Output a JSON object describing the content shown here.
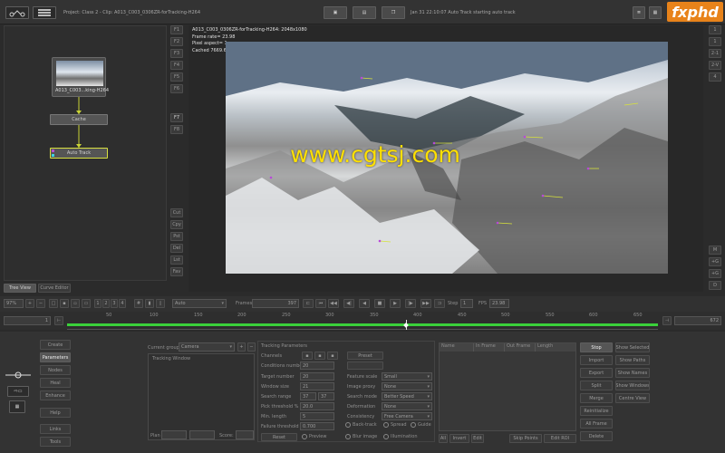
{
  "top_bar": {
    "project_label": "Project: Class 2 - Clip: A013_C003_0306ZR-forTracking-H264",
    "status_message": "Jan 31 22:10:07 Auto Track starting auto track",
    "watermark": "fxphd"
  },
  "node_graph": {
    "source_node_label": "A013_C003...king-H264",
    "cache_node_label": "Cache",
    "autotrack_node_label": "Auto Track",
    "left_tabs": [
      "F1",
      "F2",
      "F3",
      "F4",
      "F5",
      "F6",
      "F7",
      "F8"
    ],
    "lower_tabs": [
      "Cut",
      "Cpy",
      "Pst",
      "Del",
      "Lst",
      "Fav",
      "Grp"
    ]
  },
  "viewer": {
    "info_lines": [
      "A013_C003_0306ZR-forTracking-H264: 2048x1080",
      "Frame rate= 23.98",
      "Pixel aspect= 1",
      "Cached 7669.69 Mb"
    ],
    "watermark_text": "www.cgtsj.com",
    "right_buttons_top": [
      "1",
      "1",
      "2-1",
      "2-V",
      "4"
    ],
    "right_buttons_bottom": [
      "M",
      "+G",
      "+G",
      "D"
    ]
  },
  "view_tabs": [
    "Tree View",
    "Curve Editor"
  ],
  "transport": {
    "zoom": "97%",
    "cache_boxes": [
      "1",
      "2",
      "3",
      "4"
    ],
    "view_mode": "Auto",
    "frames_label": "Frames",
    "current_frame": "397",
    "step_label": "Step",
    "step_value": "1",
    "fps_label": "FPS",
    "fps_value": "23.98"
  },
  "timeline": {
    "start_frame": "1",
    "end_frame": "672",
    "tick_labels": [
      "50",
      "100",
      "150",
      "200",
      "250",
      "300",
      "350",
      "400",
      "450",
      "500",
      "550",
      "600",
      "650"
    ]
  },
  "left_panel": {
    "buttons": [
      "Create",
      "Parameters",
      "Nodes",
      "Heal",
      "Enhance",
      "Help",
      "Links",
      "Tools"
    ]
  },
  "tracking_window": {
    "current_group_label": "Current group",
    "current_group_value": "Camera",
    "title": "Tracking Window",
    "plan_label": "Plan",
    "score_label": "Score:"
  },
  "tracking_params": {
    "title": "Tracking Parameters",
    "channels_label": "Channels",
    "preset_label": "Preset",
    "conditions_label": "Conditions number",
    "conditions_value": "20",
    "rows": [
      {
        "label": "Target number",
        "value": "20",
        "label2": "Feature scale",
        "value2": "Small"
      },
      {
        "label": "Window size",
        "value": "21",
        "label2": "Image proxy",
        "value2": "None"
      },
      {
        "label": "Search range",
        "value": "37",
        "value_b": "37",
        "label2": "Search mode",
        "value2": "Better Speed"
      },
      {
        "label": "Pick threshold %",
        "value": "20.0",
        "label2": "Deformation",
        "value2": "None"
      },
      {
        "label": "Min. length",
        "value": "5",
        "label2": "Consistency",
        "value2": "Free Camera"
      },
      {
        "label": "Failure threshold",
        "value": "0.700",
        "label2": "",
        "value2": ""
      }
    ],
    "checks": [
      "Back-track",
      "Spread",
      "Guide",
      "Blur image",
      "Illumination"
    ],
    "reset_label": "Reset",
    "preview_label": "Preview"
  },
  "table": {
    "columns": [
      "Name",
      "In Frame",
      "Out Frame",
      "Length"
    ],
    "footer": [
      "All",
      "Invert",
      "Edit",
      "Skip Points",
      "Edit ROI"
    ]
  },
  "action_buttons": {
    "left": [
      "Stop",
      "Import",
      "Export",
      "Split",
      "Merge",
      "Reinitialize",
      "All Frame",
      "Delete"
    ],
    "right": [
      "Show Selected",
      "Show Paths",
      "Show Names",
      "Show Windows",
      "Centre View"
    ]
  }
}
